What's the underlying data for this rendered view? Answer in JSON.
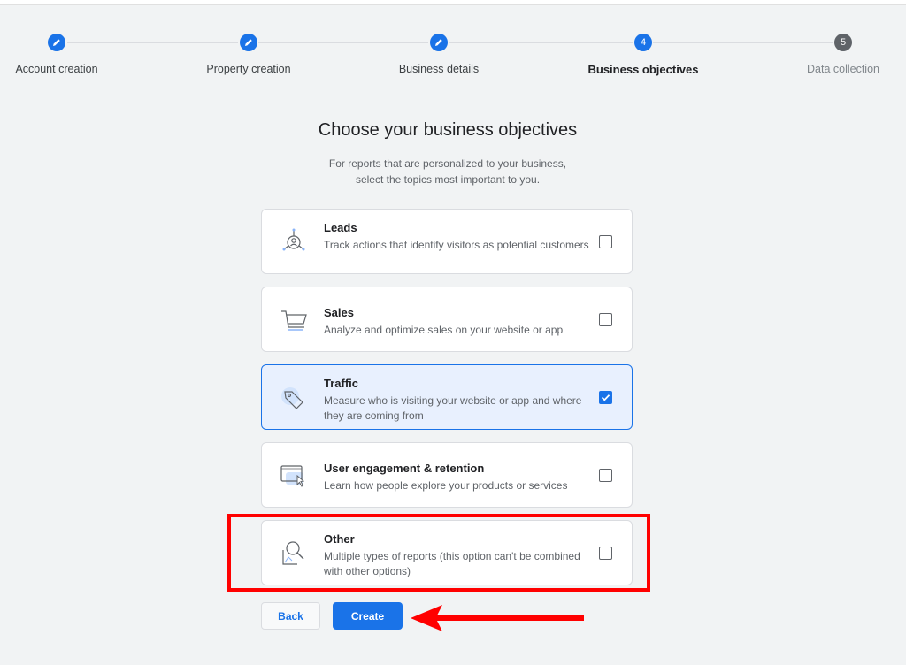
{
  "stepper": {
    "steps": [
      {
        "label": "Account creation",
        "state": "done"
      },
      {
        "label": "Property creation",
        "state": "done"
      },
      {
        "label": "Business details",
        "state": "done"
      },
      {
        "label": "Business objectives",
        "state": "active",
        "number": "4"
      },
      {
        "label": "Data collection",
        "state": "pending",
        "number": "5"
      }
    ]
  },
  "heading": {
    "title": "Choose your business objectives",
    "subtitle_line1": "For reports that are personalized to your business,",
    "subtitle_line2": "select the topics most important to you."
  },
  "objectives": [
    {
      "title": "Leads",
      "desc": "Track actions that identify visitors as potential customers",
      "checked": false,
      "icon": "leads-icon"
    },
    {
      "title": "Sales",
      "desc": "Analyze and optimize sales on your website or app",
      "checked": false,
      "icon": "cart-icon"
    },
    {
      "title": "Traffic",
      "desc": "Measure who is visiting your website or app and where they are coming from",
      "checked": true,
      "icon": "tag-icon"
    },
    {
      "title": "User engagement & retention",
      "desc": "Learn how people explore your products or services",
      "checked": false,
      "icon": "engagement-icon"
    },
    {
      "title": "Other",
      "desc": "Multiple types of reports (this option can't be combined with other options)",
      "checked": false,
      "icon": "search-report-icon"
    }
  ],
  "actions": {
    "back_label": "Back",
    "create_label": "Create"
  },
  "colors": {
    "accent": "#1a73e8",
    "annotation": "#ff0000"
  }
}
